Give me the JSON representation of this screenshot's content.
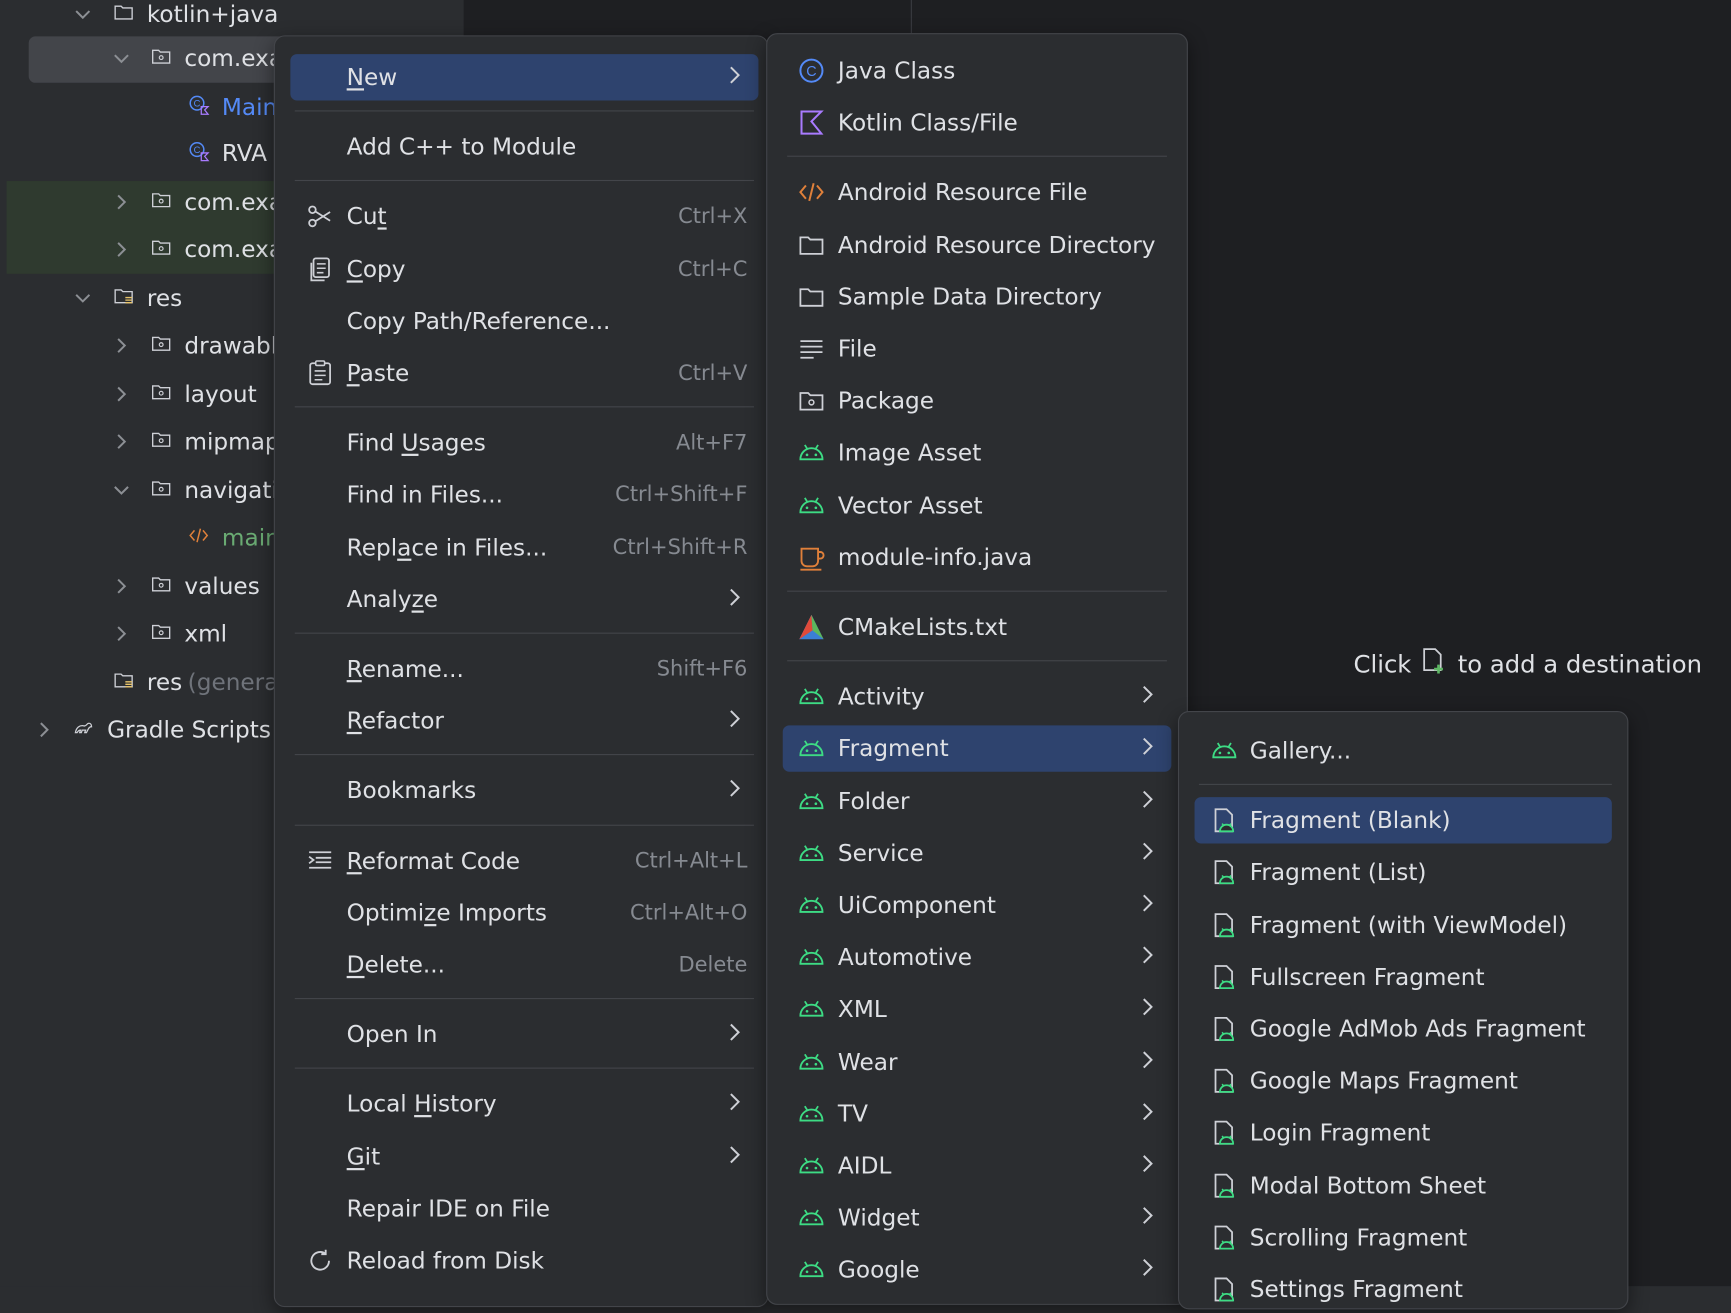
{
  "tree": [
    {
      "label": "kotlin+java",
      "chevron": "v",
      "icon": "folder-icon",
      "color": "#dfe1e5"
    },
    {
      "label": "com.exa",
      "chevron": "v",
      "icon": "package-icon",
      "color": "#dfe1e5"
    },
    {
      "label": "Main",
      "chevron": "",
      "icon": "kotlin-class-icon",
      "color": "#548af7"
    },
    {
      "label": "RVA",
      "chevron": "",
      "icon": "kotlin-class-icon",
      "color": "#dfe1e5"
    },
    {
      "label": "com.exa",
      "chevron": ">",
      "icon": "package-icon",
      "color": "#dfe1e5"
    },
    {
      "label": "com.exa",
      "chevron": ">",
      "icon": "package-icon",
      "color": "#dfe1e5"
    },
    {
      "label": "res",
      "chevron": "v",
      "icon": "res-folder-icon",
      "color": "#dfe1e5"
    },
    {
      "label": "drawable",
      "chevron": ">",
      "icon": "package-icon",
      "color": "#dfe1e5"
    },
    {
      "label": "layout",
      "chevron": ">",
      "icon": "package-icon",
      "color": "#dfe1e5"
    },
    {
      "label": "mipmap",
      "chevron": ">",
      "icon": "package-icon",
      "color": "#dfe1e5"
    },
    {
      "label": "navigatio",
      "chevron": "v",
      "icon": "package-icon",
      "color": "#dfe1e5"
    },
    {
      "label": "main",
      "chevron": "",
      "icon": "xml-icon",
      "color": "#6aab73"
    },
    {
      "label": "values",
      "chevron": ">",
      "icon": "package-icon",
      "color": "#dfe1e5"
    },
    {
      "label": "xml",
      "chevron": ">",
      "icon": "package-icon",
      "color": "#dfe1e5"
    },
    {
      "label": "res",
      "suffix": "(generat",
      "chevron": "",
      "icon": "res-folder-icon",
      "color": "#dfe1e5"
    },
    {
      "label": "Gradle Scripts",
      "chevron": ">",
      "icon": "gradle-icon",
      "color": "#dfe1e5"
    }
  ],
  "editor_hint": {
    "before": "Click",
    "after": "to add a destination"
  },
  "context_menu": {
    "items": [
      {
        "label": "New",
        "mn": "N",
        "arrow": true,
        "selected": true
      },
      {
        "sep": true
      },
      {
        "label": "Add C++ to Module"
      },
      {
        "sep": true
      },
      {
        "label": "Cut",
        "mn": "t",
        "shortcut": "Ctrl+X",
        "icon": "scissors-icon"
      },
      {
        "label": "Copy",
        "mn": "C",
        "shortcut": "Ctrl+C",
        "icon": "copy-icon"
      },
      {
        "label": "Copy Path/Reference..."
      },
      {
        "label": "Paste",
        "mn": "P",
        "shortcut": "Ctrl+V",
        "icon": "paste-icon"
      },
      {
        "sep": true
      },
      {
        "label": "Find Usages",
        "mn": "U",
        "shortcut": "Alt+F7"
      },
      {
        "label": "Find in Files...",
        "shortcut": "Ctrl+Shift+F"
      },
      {
        "label": "Replace in Files...",
        "mn": "a",
        "shortcut": "Ctrl+Shift+R"
      },
      {
        "label": "Analyze",
        "mn": "z",
        "arrow": true
      },
      {
        "sep": true
      },
      {
        "label": "Rename...",
        "mn": "R",
        "shortcut": "Shift+F6"
      },
      {
        "label": "Refactor",
        "mn": "R",
        "arrow": true
      },
      {
        "sep": true
      },
      {
        "label": "Bookmarks",
        "arrow": true
      },
      {
        "sep": true
      },
      {
        "label": "Reformat Code",
        "mn": "R",
        "shortcut": "Ctrl+Alt+L",
        "icon": "reformat-icon"
      },
      {
        "label": "Optimize Imports",
        "mn": "z",
        "shortcut": "Ctrl+Alt+O"
      },
      {
        "label": "Delete...",
        "mn": "D",
        "shortcut": "Delete"
      },
      {
        "sep": true
      },
      {
        "label": "Open In",
        "arrow": true
      },
      {
        "sep": true
      },
      {
        "label": "Local History",
        "mn": "H",
        "arrow": true
      },
      {
        "label": "Git",
        "mn": "G",
        "arrow": true
      },
      {
        "label": "Repair IDE on File"
      },
      {
        "label": "Reload from Disk",
        "icon": "reload-icon"
      }
    ]
  },
  "new_submenu": {
    "items": [
      {
        "label": "Java Class",
        "icon": "java-class-icon"
      },
      {
        "label": "Kotlin Class/File",
        "icon": "kotlin-icon"
      },
      {
        "sep": true
      },
      {
        "label": "Android Resource File",
        "icon": "xml-icon"
      },
      {
        "label": "Android Resource Directory",
        "icon": "folder-icon"
      },
      {
        "label": "Sample Data Directory",
        "icon": "folder-icon"
      },
      {
        "label": "File",
        "icon": "text-file-icon"
      },
      {
        "label": "Package",
        "icon": "package-icon"
      },
      {
        "label": "Image Asset",
        "icon": "android-icon"
      },
      {
        "label": "Vector Asset",
        "icon": "android-icon"
      },
      {
        "label": "module-info.java",
        "icon": "cup-icon"
      },
      {
        "sep": true
      },
      {
        "label": "CMakeLists.txt",
        "icon": "cmake-icon"
      },
      {
        "sep": true
      },
      {
        "label": "Activity",
        "icon": "android-icon",
        "arrow": true
      },
      {
        "label": "Fragment",
        "icon": "android-icon",
        "arrow": true,
        "selected": true
      },
      {
        "label": "Folder",
        "icon": "android-icon",
        "arrow": true
      },
      {
        "label": "Service",
        "icon": "android-icon",
        "arrow": true
      },
      {
        "label": "UiComponent",
        "icon": "android-icon",
        "arrow": true
      },
      {
        "label": "Automotive",
        "icon": "android-icon",
        "arrow": true
      },
      {
        "label": "XML",
        "icon": "android-icon",
        "arrow": true
      },
      {
        "label": "Wear",
        "icon": "android-icon",
        "arrow": true
      },
      {
        "label": "TV",
        "icon": "android-icon",
        "arrow": true
      },
      {
        "label": "AIDL",
        "icon": "android-icon",
        "arrow": true
      },
      {
        "label": "Widget",
        "icon": "android-icon",
        "arrow": true
      },
      {
        "label": "Google",
        "icon": "android-icon",
        "arrow": true
      }
    ]
  },
  "fragment_submenu": {
    "items": [
      {
        "label": "Gallery...",
        "icon": "android-icon"
      },
      {
        "sep": true
      },
      {
        "label": "Fragment (Blank)",
        "icon": "android-file-icon",
        "selected": true
      },
      {
        "label": "Fragment (List)",
        "icon": "android-file-icon"
      },
      {
        "label": "Fragment (with ViewModel)",
        "icon": "android-file-icon"
      },
      {
        "label": "Fullscreen Fragment",
        "icon": "android-file-icon"
      },
      {
        "label": "Google AdMob Ads Fragment",
        "icon": "android-file-icon"
      },
      {
        "label": "Google Maps Fragment",
        "icon": "android-file-icon"
      },
      {
        "label": "Login Fragment",
        "icon": "android-file-icon"
      },
      {
        "label": "Modal Bottom Sheet",
        "icon": "android-file-icon"
      },
      {
        "label": "Scrolling Fragment",
        "icon": "android-file-icon"
      },
      {
        "label": "Settings Fragment",
        "icon": "android-file-icon"
      }
    ]
  },
  "colors": {
    "background": "#2b2d30",
    "editor": "#1e1f22",
    "selection": "#2e436e",
    "separator": "#43454a",
    "android_green": "#3ddc84",
    "java_blue": "#548af7",
    "kotlin_purple": "#a97bff",
    "xml_orange": "#e0803a"
  }
}
